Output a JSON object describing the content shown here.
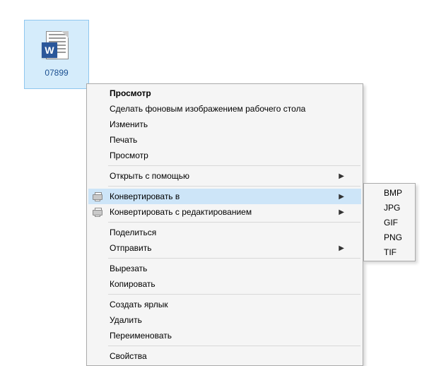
{
  "file": {
    "label": "07899"
  },
  "menu": {
    "preview_bold": "Просмотр",
    "set_wallpaper": "Сделать фоновым изображением рабочего стола",
    "edit": "Изменить",
    "print": "Печать",
    "preview": "Просмотр",
    "open_with": "Открыть с помощью",
    "convert_to": "Конвертировать в",
    "convert_with_edit": "Конвертировать с редактированием",
    "share": "Поделиться",
    "send_to": "Отправить",
    "cut": "Вырезать",
    "copy": "Копировать",
    "create_shortcut": "Создать ярлык",
    "delete": "Удалить",
    "rename": "Переименовать",
    "properties": "Свойства"
  },
  "submenu": {
    "bmp": "BMP",
    "jpg": "JPG",
    "gif": "GIF",
    "png": "PNG",
    "tif": "TIF"
  }
}
